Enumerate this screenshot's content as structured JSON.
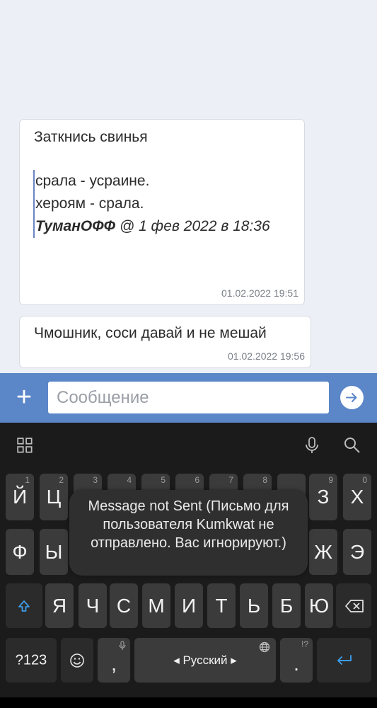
{
  "messages": [
    {
      "text": "Заткнись свинья",
      "quote": {
        "line1": "срала - усраине.",
        "line2": "хероям - срала.",
        "author": "ТуманОФФ",
        "meta": " @ 1 фев 2022 в 18:36"
      },
      "time": "01.02.2022 19:51"
    },
    {
      "text": "Чмошник, соси давай и не мешай",
      "time": "01.02.2022 19:56"
    }
  ],
  "composer": {
    "placeholder": "Сообщение",
    "add_icon": "plus-icon",
    "send_icon": "send-arrow-icon"
  },
  "keyboard": {
    "top_icons": [
      "apps-grid-icon",
      "microphone-icon",
      "search-icon"
    ],
    "row1": [
      {
        "label": "Й",
        "hint": "1"
      },
      {
        "label": "Ц",
        "hint": "2"
      },
      {
        "label": "",
        "hint": "3"
      },
      {
        "label": "",
        "hint": "4"
      },
      {
        "label": "",
        "hint": "5"
      },
      {
        "label": "",
        "hint": "6"
      },
      {
        "label": "",
        "hint": "7"
      },
      {
        "label": "",
        "hint": "8"
      },
      {
        "label": "З",
        "hint": "9"
      },
      {
        "label": "Х",
        "hint": "0"
      }
    ],
    "row2": [
      "Ф",
      "Ы",
      "Ж",
      "Э"
    ],
    "row3": [
      "Я",
      "Ч",
      "С",
      "М",
      "И",
      "Т",
      "Ь",
      "Б",
      "Ю"
    ],
    "row4": {
      "num_label": "?123",
      "comma": ",",
      "space_label": "◂ Русский ▸",
      "period": ".",
      "period_hint": "!?"
    }
  },
  "toast": {
    "text": "Message not Sent (Письмо для пользователя Kumkwat не отправлено. Вас игнорируют.)"
  },
  "colors": {
    "accent": "#5b86c8",
    "quote_bar": "#6c84c6",
    "keyboard_bg": "#1b1b1b",
    "key_bg": "#3b3b3b"
  }
}
